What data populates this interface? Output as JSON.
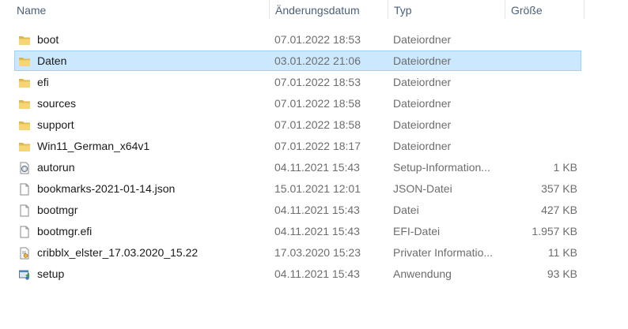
{
  "columns": {
    "name": "Name",
    "date": "Änderungsdatum",
    "type": "Typ",
    "size": "Größe"
  },
  "files": [
    {
      "name": "boot",
      "date": "07.01.2022 18:53",
      "type": "Dateiordner",
      "size": "",
      "icon": "folder-icon"
    },
    {
      "name": "Daten",
      "date": "03.01.2022 21:06",
      "type": "Dateiordner",
      "size": "",
      "icon": "folder-icon",
      "selected": true
    },
    {
      "name": "efi",
      "date": "07.01.2022 18:53",
      "type": "Dateiordner",
      "size": "",
      "icon": "folder-icon"
    },
    {
      "name": "sources",
      "date": "07.01.2022 18:58",
      "type": "Dateiordner",
      "size": "",
      "icon": "folder-icon"
    },
    {
      "name": "support",
      "date": "07.01.2022 18:58",
      "type": "Dateiordner",
      "size": "",
      "icon": "folder-icon"
    },
    {
      "name": "Win11_German_x64v1",
      "date": "07.01.2022 18:17",
      "type": "Dateiordner",
      "size": "",
      "icon": "folder-icon"
    },
    {
      "name": "autorun",
      "date": "04.11.2021 15:43",
      "type": "Setup-Information...",
      "size": "1 KB",
      "icon": "setup-information-icon"
    },
    {
      "name": "bookmarks-2021-01-14.json",
      "date": "15.01.2021 12:01",
      "type": "JSON-Datei",
      "size": "357 KB",
      "icon": "file-icon"
    },
    {
      "name": "bootmgr",
      "date": "04.11.2021 15:43",
      "type": "Datei",
      "size": "427 KB",
      "icon": "file-icon"
    },
    {
      "name": "bootmgr.efi",
      "date": "04.11.2021 15:43",
      "type": "EFI-Datei",
      "size": "1.957 KB",
      "icon": "file-icon"
    },
    {
      "name": "cribblx_elster_17.03.2020_15.22",
      "date": "17.03.2020 15:23",
      "type": "Privater Informatio...",
      "size": "11 KB",
      "icon": "certificate-file-icon"
    },
    {
      "name": "setup",
      "date": "04.11.2021 15:43",
      "type": "Anwendung",
      "size": "93 KB",
      "icon": "application-icon"
    }
  ]
}
